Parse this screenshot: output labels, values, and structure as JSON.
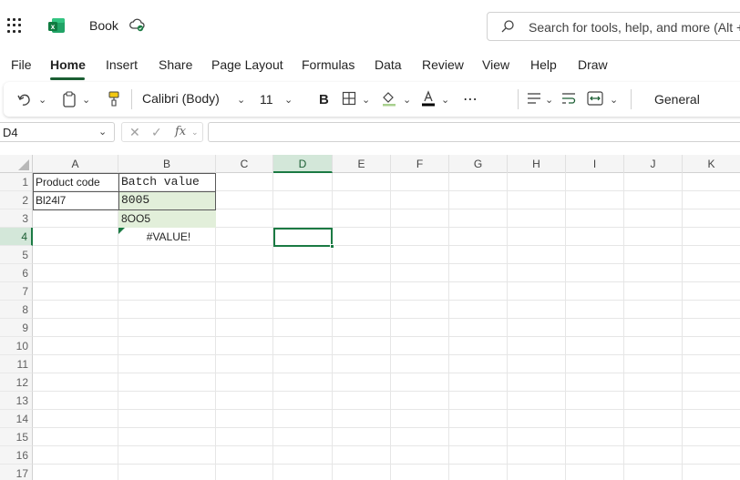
{
  "titlebar": {
    "book_name": "Book",
    "search_placeholder": "Search for tools, help, and more (Alt + Q)"
  },
  "menu": {
    "tabs": [
      "File",
      "Home",
      "Insert",
      "Share",
      "Page Layout",
      "Formulas",
      "Data",
      "Review",
      "View",
      "Help",
      "Draw"
    ],
    "active": "Home"
  },
  "ribbon": {
    "font_name": "Calibri (Body)",
    "font_size": "11",
    "number_format": "General",
    "bold_label": "B"
  },
  "formula_bar": {
    "name_box": "D4",
    "formula": ""
  },
  "grid": {
    "columns": [
      "A",
      "B",
      "C",
      "D",
      "E",
      "F",
      "G",
      "H",
      "I",
      "J",
      "K"
    ],
    "selected_column": "D",
    "rows": [
      "1",
      "2",
      "3",
      "4",
      "5",
      "6",
      "7",
      "8",
      "9",
      "10",
      "11",
      "12",
      "13",
      "14",
      "15",
      "16",
      "17"
    ],
    "selected_row": "4",
    "cells": {
      "A1": "Product code",
      "B1": "Batch value",
      "A2": "Bl24l7",
      "B2": "8005",
      "B3": "8OO5",
      "B4": "#VALUE!"
    },
    "accent_color": "#1b7a43",
    "highlight_fill": "#e2efda"
  }
}
